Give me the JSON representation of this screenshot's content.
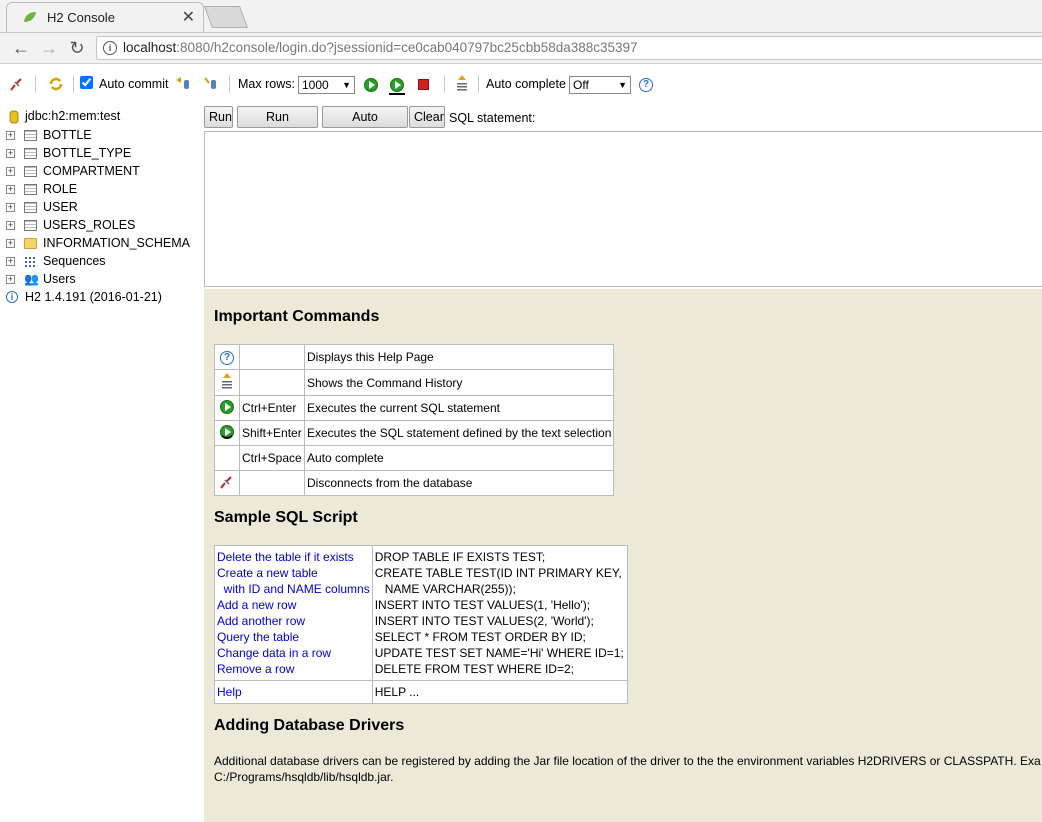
{
  "browser": {
    "tab_title": "H2 Console",
    "tab_close": "✕",
    "url_host": "localhost",
    "url_rest": ":8080/h2console/login.do?jsessionid=ce0cab040797bc25cbb58da388c35397"
  },
  "toolbar": {
    "auto_commit_label": "Auto commit",
    "max_rows_label": "Max rows:",
    "max_rows_value": "1000",
    "auto_complete_label": "Auto complete",
    "auto_complete_value": "Off"
  },
  "tree": {
    "connection": "jdbc:h2:mem:test",
    "items": [
      {
        "label": "BOTTLE",
        "icon": "table-icon"
      },
      {
        "label": "BOTTLE_TYPE",
        "icon": "table-icon"
      },
      {
        "label": "COMPARTMENT",
        "icon": "table-icon"
      },
      {
        "label": "ROLE",
        "icon": "table-icon"
      },
      {
        "label": "USER",
        "icon": "table-icon"
      },
      {
        "label": "USERS_ROLES",
        "icon": "table-icon"
      },
      {
        "label": "INFORMATION_SCHEMA",
        "icon": "folder-icon"
      },
      {
        "label": "Sequences",
        "icon": "sequence-icon"
      },
      {
        "label": "Users",
        "icon": "users-icon"
      }
    ],
    "version": "H2 1.4.191 (2016-01-21)"
  },
  "sql": {
    "run": "Run",
    "run_selected": "Run Selected",
    "auto_complete": "Auto complete",
    "clear": "Clear",
    "statement_label": "SQL statement:"
  },
  "help": {
    "important_title": "Important Commands",
    "commands": [
      {
        "icon": "help-icon",
        "key": "",
        "desc": "Displays this Help Page"
      },
      {
        "icon": "history-icon",
        "key": "",
        "desc": "Shows the Command History"
      },
      {
        "icon": "run-icon",
        "key": "Ctrl+Enter",
        "desc": "Executes the current SQL statement"
      },
      {
        "icon": "run-selected-icon",
        "key": "Shift+Enter",
        "desc": "Executes the SQL statement defined by the text selection"
      },
      {
        "icon": "",
        "key": "Ctrl+Space",
        "desc": "Auto complete"
      },
      {
        "icon": "disconnect-icon",
        "key": "",
        "desc": "Disconnects from the database"
      }
    ],
    "sample_title": "Sample SQL Script",
    "sample_rows": [
      {
        "link": "Delete the table if it exists",
        "code": "DROP TABLE IF EXISTS TEST;"
      },
      {
        "link": "Create a new table",
        "code": "CREATE TABLE TEST(ID INT PRIMARY KEY,"
      },
      {
        "link": "  with ID and NAME columns",
        "code": "   NAME VARCHAR(255));"
      },
      {
        "link": "Add a new row",
        "code": "INSERT INTO TEST VALUES(1, 'Hello');"
      },
      {
        "link": "Add another row",
        "code": "INSERT INTO TEST VALUES(2, 'World');"
      },
      {
        "link": "Query the table",
        "code": "SELECT * FROM TEST ORDER BY ID;"
      },
      {
        "link": "Change data in a row",
        "code": "UPDATE TEST SET NAME='Hi' WHERE ID=1;"
      },
      {
        "link": "Remove a row",
        "code": "DELETE FROM TEST WHERE ID=2;"
      }
    ],
    "help_link": "Help",
    "help_code": "HELP ...",
    "drivers_title": "Adding Database Drivers",
    "drivers_line1": "Additional database drivers can be registered by adding the Jar file location of the driver to the the environment variables H2DRIVERS or CLASSPATH. Exa",
    "drivers_line2": "C:/Programs/hsqldb/lib/hsqldb.jar."
  }
}
